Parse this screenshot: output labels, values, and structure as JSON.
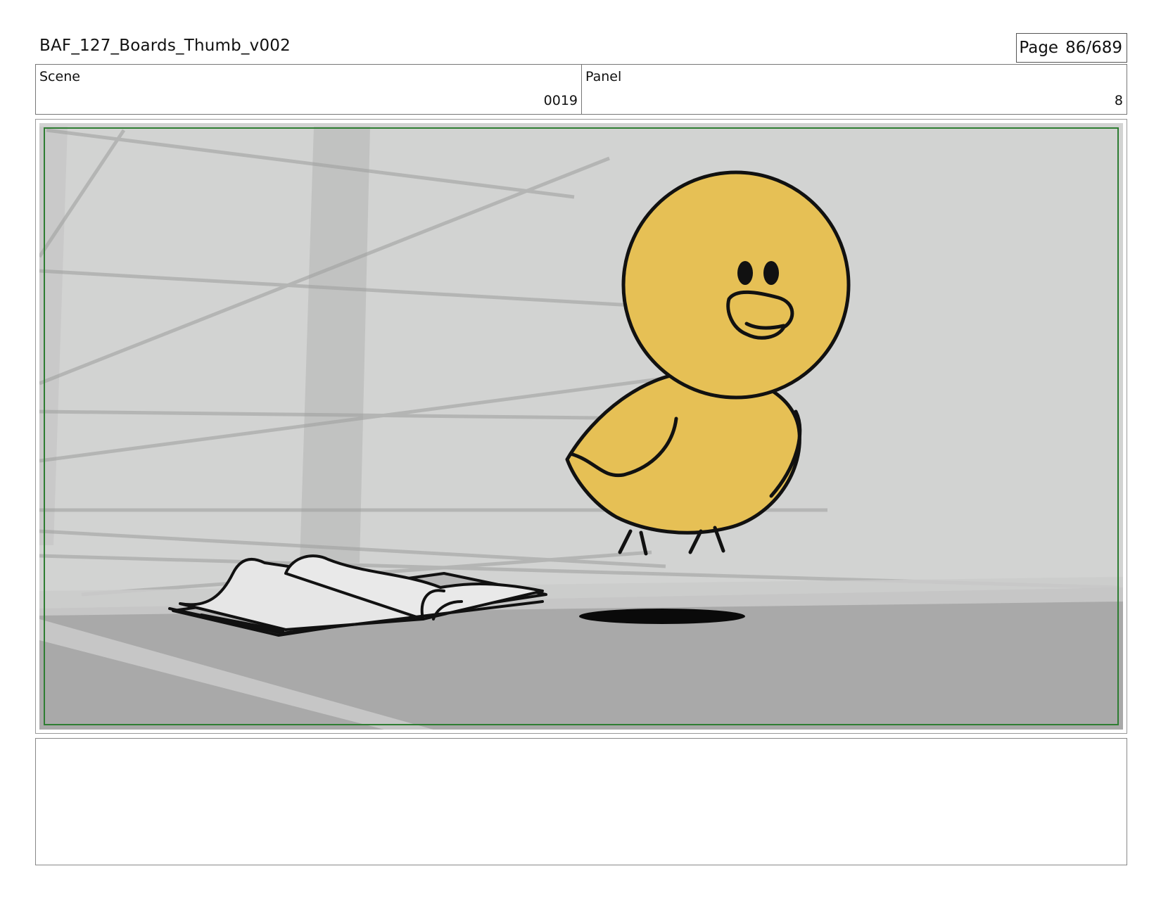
{
  "header": {
    "doc_title": "BAF_127_Boards_Thumb_v002",
    "page_label": "Page",
    "page_number": "86/689"
  },
  "info": {
    "scene_label": "Scene",
    "scene_value": "0019",
    "panel_label": "Panel",
    "panel_value": "8"
  },
  "panel_art": {
    "description_icons": [
      "duck-character",
      "open-book",
      "shadow"
    ],
    "colors": {
      "wall": "#d1d2d1",
      "floor": "#aeaeae",
      "duck": "#e7c156",
      "safe_frame": "#2e7d32"
    }
  },
  "notes": {
    "text": ""
  }
}
